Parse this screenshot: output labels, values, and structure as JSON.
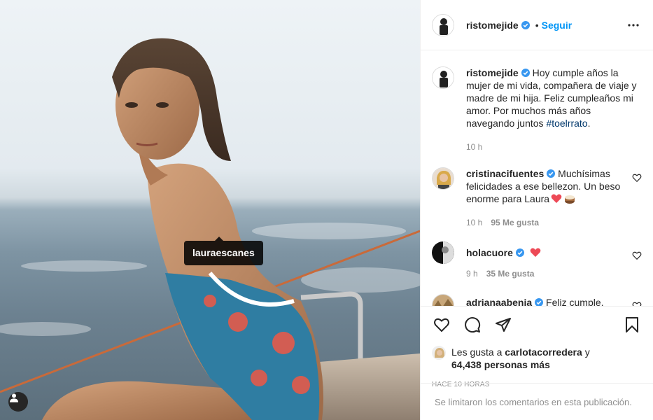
{
  "photo": {
    "tag_label": "lauraescanes"
  },
  "header": {
    "username": "ristomejide",
    "separator": "•",
    "follow_label": "Seguir"
  },
  "caption": {
    "username": "ristomejide",
    "text": "Hoy cumple años la mujer de mi vida, compañera de viaje y madre de mi hija. Feliz cumpleaños mi amor. Por muchos más años navegando juntos ",
    "hashtag": "#toelrrato",
    "end": ".",
    "time": "10 h"
  },
  "comments": [
    {
      "username": "cristinacifuentes",
      "text": "Muchísimas felicidades a ese bellezon. Un beso enorme para Laura",
      "time": "10 h",
      "likes": "95 Me gusta"
    },
    {
      "username": "holacuore",
      "text": "",
      "time": "9 h",
      "likes": "35 Me gusta"
    },
    {
      "username": "adrianaabenia",
      "text": "Feliz cumple,"
    }
  ],
  "likes": {
    "prefix": "Les gusta a",
    "user": "carlotacorredera",
    "conj": "y",
    "others": "64,438 personas más"
  },
  "timestamp": "Hace 10 horas",
  "comments_limited": "Se limitaron los comentarios en esta publicación.",
  "colors": {
    "accent": "#0095f6",
    "verified": "#3897f0",
    "heart": "#ed4956"
  }
}
